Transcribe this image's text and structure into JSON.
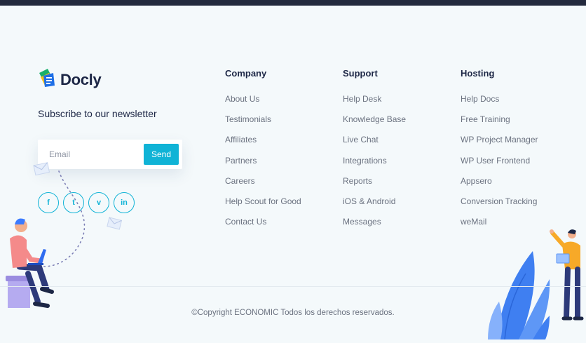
{
  "brand": {
    "name": "Docly"
  },
  "newsletter": {
    "heading": "Subscribe to our newsletter",
    "email_placeholder": "Email",
    "send_label": "Send"
  },
  "socials": [
    {
      "glyph": "f",
      "icon": "facebook-icon"
    },
    {
      "glyph": "t",
      "icon": "twitter-icon"
    },
    {
      "glyph": "v",
      "icon": "vimeo-icon"
    },
    {
      "glyph": "in",
      "icon": "linkedin-icon"
    }
  ],
  "columns": [
    {
      "title": "Company",
      "items": [
        "About Us",
        "Testimonials",
        "Affiliates",
        "Partners",
        "Careers",
        "Help Scout for Good",
        "Contact Us"
      ]
    },
    {
      "title": "Support",
      "items": [
        "Help Desk",
        "Knowledge Base",
        "Live Chat",
        "Integrations",
        "Reports",
        "iOS & Android",
        "Messages"
      ]
    },
    {
      "title": "Hosting",
      "items": [
        "Help Docs",
        "Free Training",
        "WP Project Manager",
        "WP User Frontend",
        "Appsero",
        "Conversion Tracking",
        "weMail"
      ]
    }
  ],
  "footer": {
    "copyright": "©Copyright ECONOMIC Todos los derechos reservados."
  },
  "colors": {
    "accent": "#10b3d6",
    "heading": "#1d2746",
    "link": "#6b7280",
    "background": "#f4f9fb"
  }
}
